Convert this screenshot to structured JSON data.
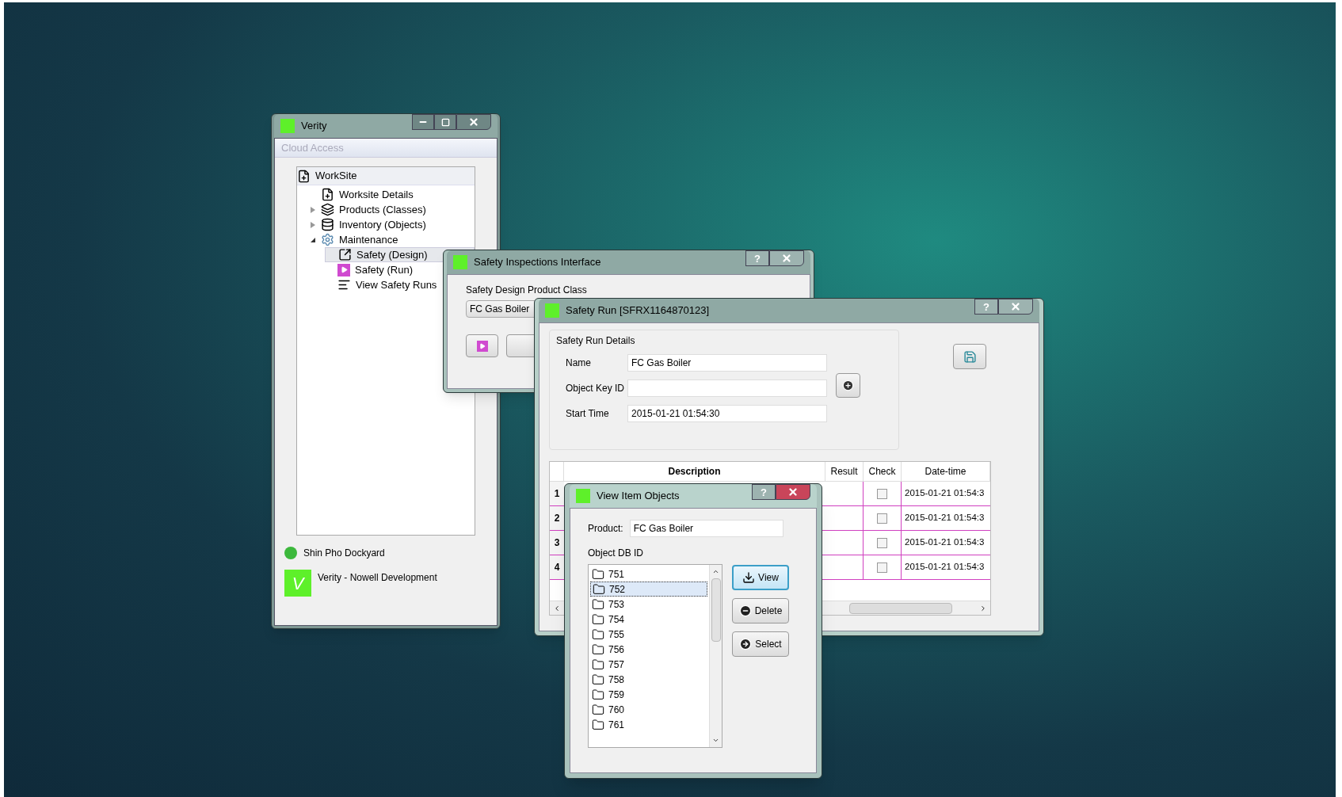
{
  "verity": {
    "title": "Verity",
    "active": false,
    "menu_header": "Cloud Access",
    "tree": {
      "label": "WorkSite",
      "selected": false,
      "children": [
        {
          "label": "Worksite Details",
          "selected": false
        },
        {
          "label": "Products (Classes)",
          "expanded": false,
          "selected": false
        },
        {
          "label": "Inventory (Objects)",
          "expanded": false,
          "selected": false
        },
        {
          "label": "Maintenance",
          "expanded": true,
          "selected": false,
          "children": [
            {
              "label": "Safety (Design)",
              "selected": true
            },
            {
              "label": "Safety (Run)",
              "selected": false
            },
            {
              "label": "View Safety Runs",
              "selected": false
            }
          ]
        }
      ]
    },
    "status": {
      "label": "Shin Pho Dockyard",
      "color": "#3cb83c"
    },
    "logo_letter": "V",
    "footer_text": "Verity - Nowell Development"
  },
  "safety_inspections": {
    "title": "Safety Inspections Interface",
    "active": false,
    "help": "?",
    "class_label": "Safety Design Product Class",
    "class_value": "FC Gas Boiler"
  },
  "safety_run": {
    "title": "Safety Run [SFRX1164870123]",
    "active": false,
    "help": "?",
    "group_title": "Safety Run Details",
    "fields": [
      {
        "label": "Name",
        "value": "FC Gas Boiler"
      },
      {
        "label": "Object Key ID"
      },
      {
        "label": "Start Time",
        "value": "2015-01-21 01:54:30"
      }
    ],
    "table": {
      "columns": [
        "Description",
        "Result",
        "Check",
        "Date-time"
      ],
      "rows": [
        {
          "number": "1",
          "checked": false,
          "date_time": "2015-01-21 01:54:3"
        },
        {
          "number": "2",
          "checked": false,
          "date_time": "2015-01-21 01:54:3"
        },
        {
          "number": "3",
          "checked": false,
          "date_time": "2015-01-21 01:54:3"
        },
        {
          "number": "4",
          "checked": false,
          "date_time": "2015-01-21 01:54:3"
        }
      ]
    }
  },
  "view_item_objects": {
    "title": "View Item Objects",
    "active": true,
    "help": "?",
    "product_label": "Product:",
    "product_value": "FC Gas Boiler",
    "list_label": "Object DB ID",
    "items": [
      {
        "label": "751",
        "selected": false
      },
      {
        "label": "752",
        "selected": true
      },
      {
        "label": "753",
        "selected": false
      },
      {
        "label": "754",
        "selected": false
      },
      {
        "label": "755",
        "selected": false
      },
      {
        "label": "756",
        "selected": false
      },
      {
        "label": "757",
        "selected": false
      },
      {
        "label": "758",
        "selected": false
      },
      {
        "label": "759",
        "selected": false
      },
      {
        "label": "760",
        "selected": false
      },
      {
        "label": "761",
        "selected": false
      }
    ],
    "buttons": [
      {
        "label": "View",
        "focused": true
      },
      {
        "label": "Delete",
        "focused": false
      },
      {
        "label": "Select",
        "focused": false
      }
    ]
  }
}
